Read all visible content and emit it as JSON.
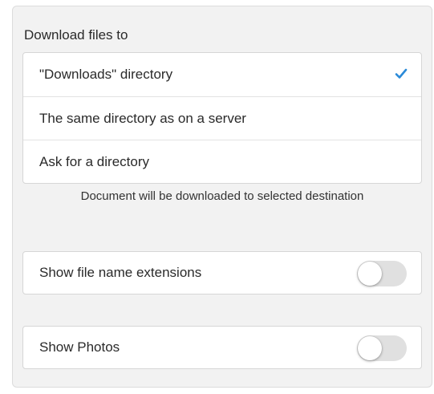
{
  "download": {
    "section_label": "Download files to",
    "options": [
      {
        "label": "\"Downloads\" directory",
        "selected": true
      },
      {
        "label": "The same directory as on a server",
        "selected": false
      },
      {
        "label": "Ask for a directory",
        "selected": false
      }
    ],
    "hint": "Document will be downloaded to selected destination",
    "check_icon": "checkmark-icon"
  },
  "settings": {
    "show_extensions_label": "Show file name extensions",
    "show_extensions_on": false,
    "show_photos_label": "Show Photos",
    "show_photos_on": false
  },
  "colors": {
    "accent": "#2a8ad8",
    "panel_bg": "#f2f2f2",
    "switch_off": "#e0e0e0"
  }
}
